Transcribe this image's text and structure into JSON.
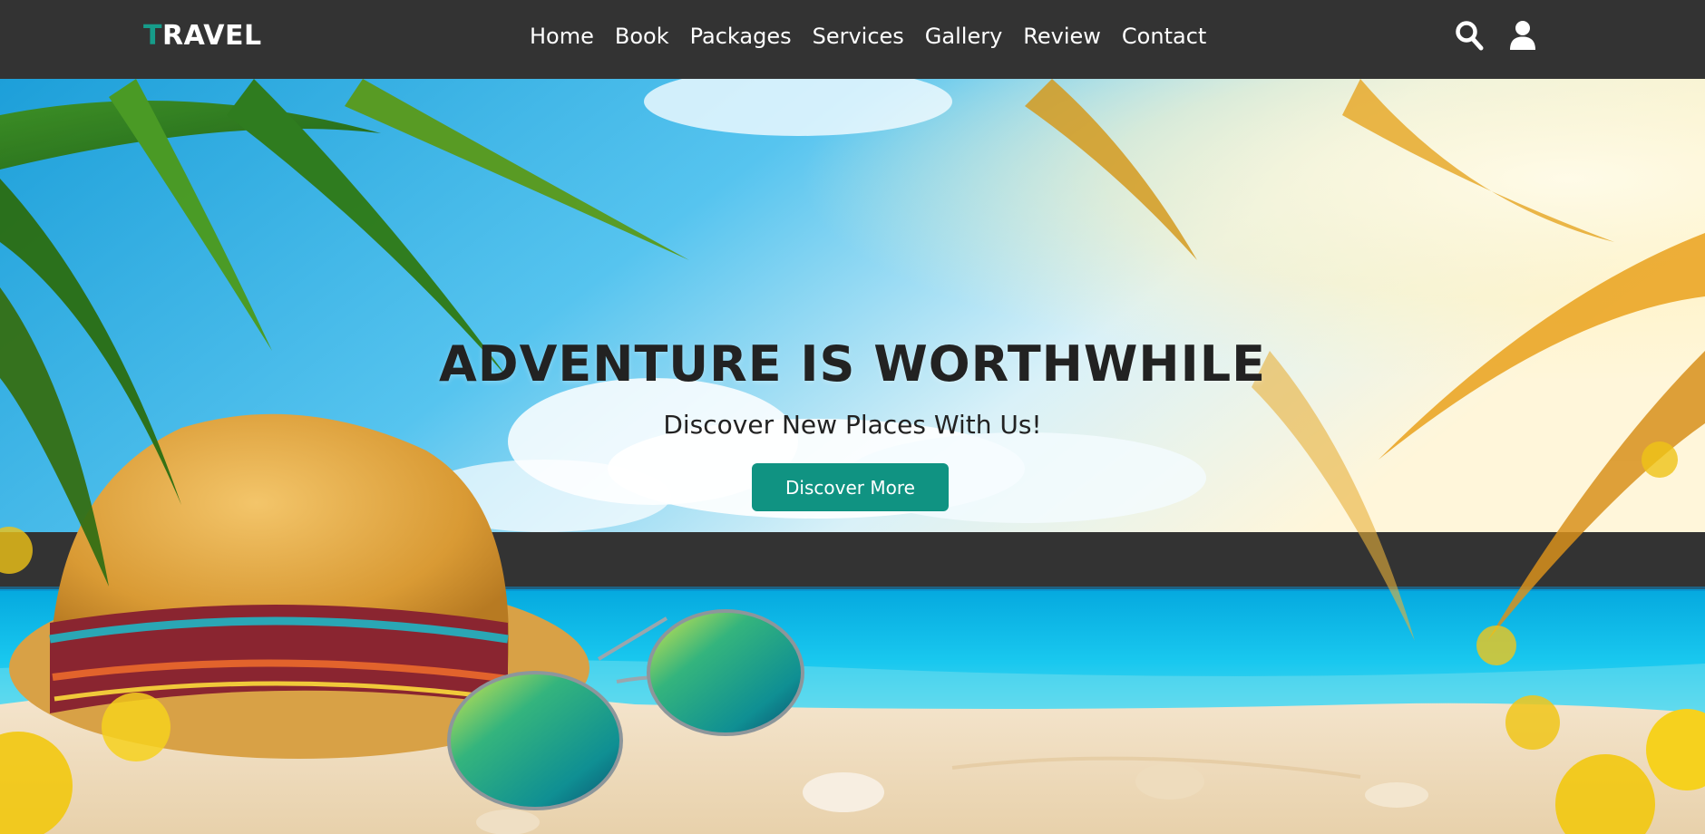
{
  "navbar": {
    "logo_first": "T",
    "logo_rest": "RAVEL",
    "links": [
      "Home",
      "Book",
      "Packages",
      "Services",
      "Gallery",
      "Review",
      "Contact"
    ],
    "icons": [
      "search-icon",
      "user-icon"
    ]
  },
  "hero": {
    "title": "ADVENTURE IS WORTHWHILE",
    "subtitle": "Discover New Places With Us!",
    "button_label": "Discover More"
  },
  "colors": {
    "navbar_bg": "#333333",
    "accent": "#109382",
    "text_dark": "#222222"
  }
}
